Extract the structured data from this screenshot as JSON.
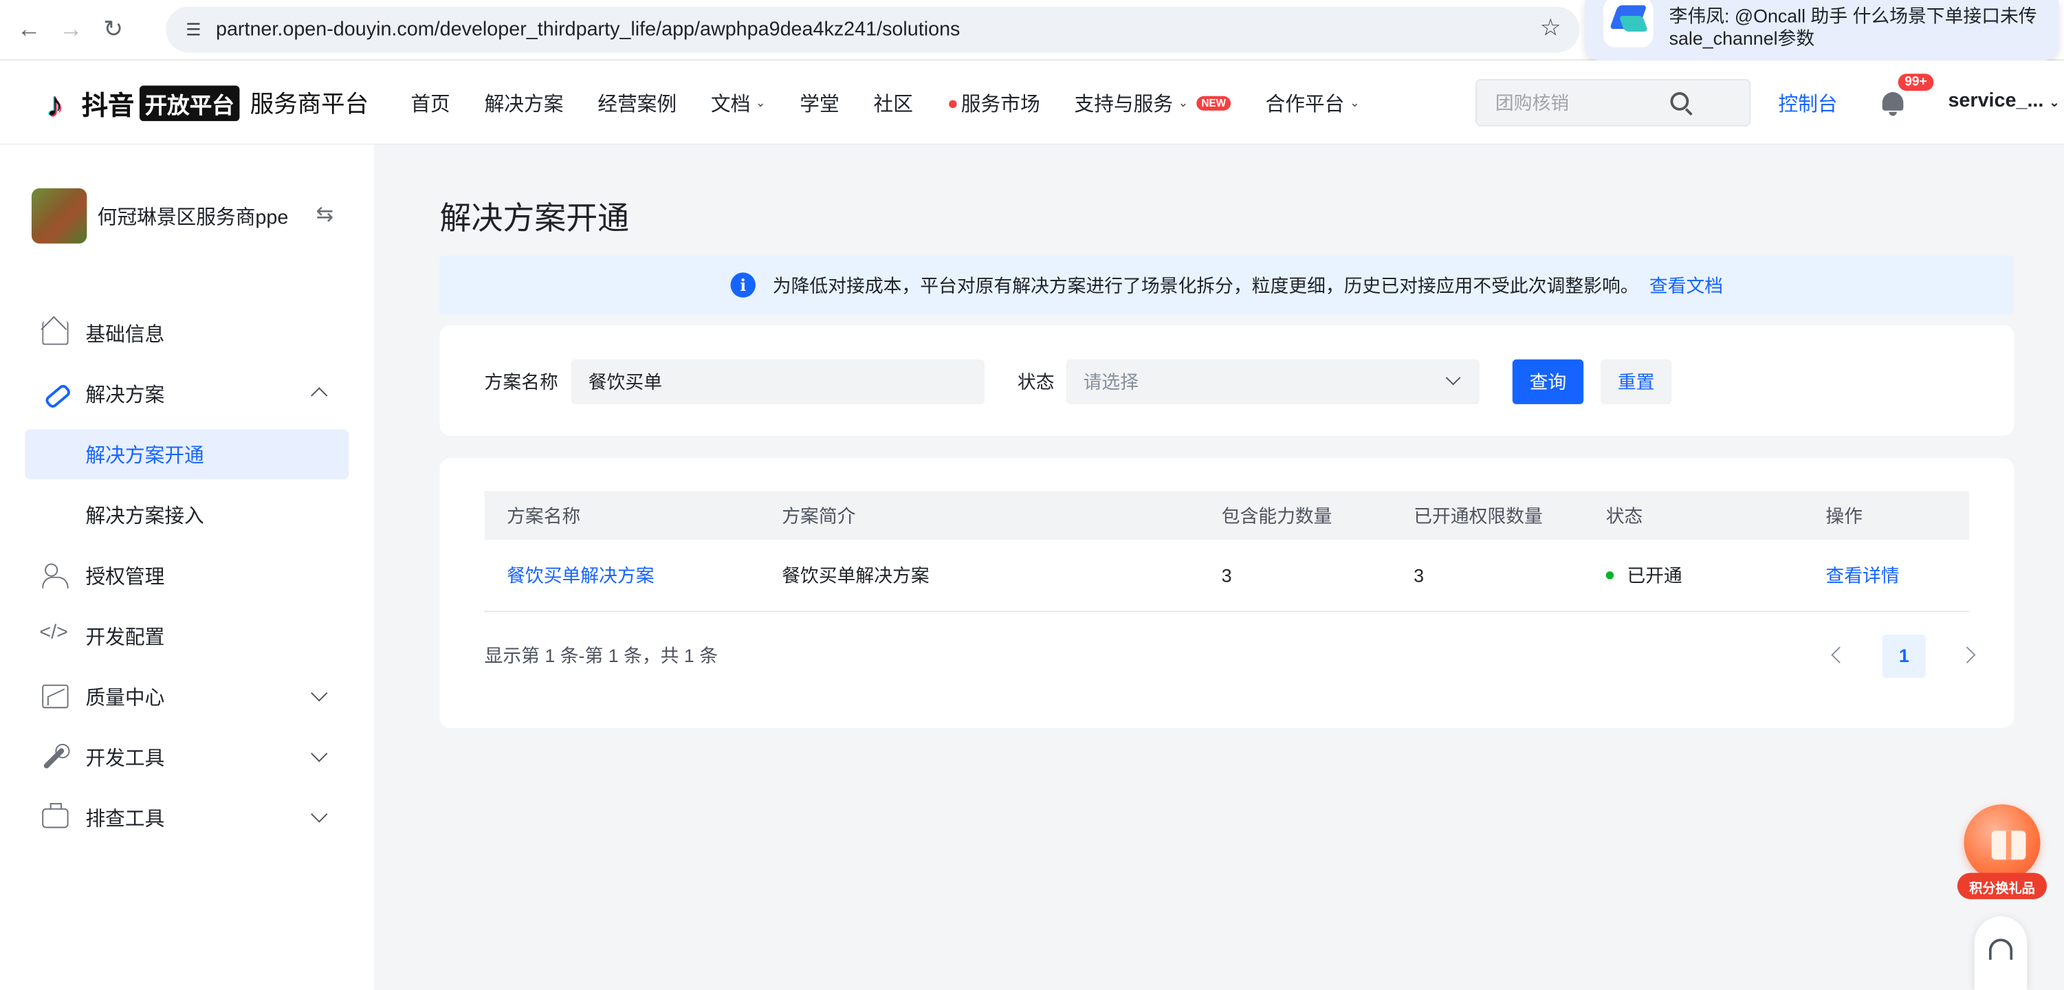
{
  "browser": {
    "url": "partner.open-douyin.com/developer_thirdparty_life/app/awphpa9dea4kz241/solutions"
  },
  "notification": {
    "text": "李伟凤: @Oncall 助手 什么场景下单接口未传sale_channel参数"
  },
  "header": {
    "brand": "抖音",
    "badge": "开放平台",
    "subtitle": "服务商平台",
    "nav": [
      {
        "label": "首页"
      },
      {
        "label": "解决方案"
      },
      {
        "label": "经营案例"
      },
      {
        "label": "文档"
      },
      {
        "label": "学堂"
      },
      {
        "label": "社区"
      },
      {
        "label": "服务市场"
      },
      {
        "label": "支持与服务"
      },
      {
        "label": "合作平台"
      }
    ],
    "new_badge": "NEW",
    "search_placeholder": "团购核销",
    "console": "控制台",
    "notify_count": "99+",
    "user": "service_..."
  },
  "sidebar": {
    "org_name": "何冠琳景区服务商ppe",
    "items": [
      {
        "label": "基础信息",
        "icon": "home-icon"
      },
      {
        "label": "解决方案",
        "icon": "link-icon",
        "expanded": true
      },
      {
        "label": "授权管理",
        "icon": "people-icon"
      },
      {
        "label": "开发配置",
        "icon": "code-icon"
      },
      {
        "label": "质量中心",
        "icon": "chart-icon"
      },
      {
        "label": "开发工具",
        "icon": "wrench-icon"
      },
      {
        "label": "排查工具",
        "icon": "toolbox-icon"
      }
    ],
    "sub_items": [
      {
        "label": "解决方案开通",
        "active": true
      },
      {
        "label": "解决方案接入"
      }
    ]
  },
  "main": {
    "title": "解决方案开通",
    "info": "为降低对接成本，平台对原有解决方案进行了场景化拆分，粒度更细，历史已对接应用不受此次调整影响。",
    "info_link": "查看文档",
    "filter": {
      "name_label": "方案名称",
      "name_value": "餐饮买单",
      "status_label": "状态",
      "status_placeholder": "请选择",
      "query": "查询",
      "reset": "重置"
    },
    "table": {
      "columns": [
        "方案名称",
        "方案简介",
        "包含能力数量",
        "已开通权限数量",
        "状态",
        "操作"
      ],
      "rows": [
        {
          "name": "餐饮买单解决方案",
          "desc": "餐饮买单解决方案",
          "abilities": "3",
          "granted": "3",
          "status": "已开通",
          "action": "查看详情"
        }
      ]
    },
    "pager_info": "显示第 1 条-第 1 条，共 1 条",
    "page": "1"
  },
  "floating": {
    "gift_label": "积分换礼品"
  },
  "colors": {
    "primary": "#1664ff",
    "success": "#00b42a",
    "danger": "#f53f3f"
  }
}
